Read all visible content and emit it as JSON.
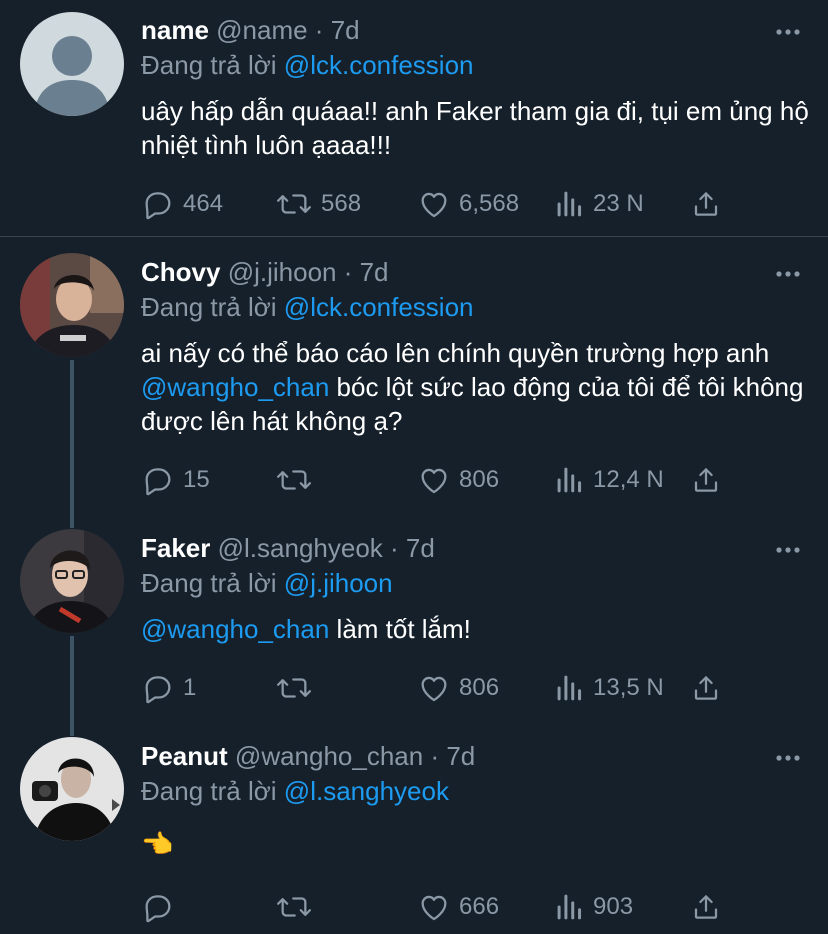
{
  "reply_prefix": "Đang trả lời",
  "tweets": [
    {
      "name": "name",
      "handle": "@name · 7d",
      "reply_to": "@lck.confession",
      "text": "uây hấp dẫn quáaa!! anh Faker tham gia đi, tụi em ủng hộ nhiệt tình luôn ạaaa!!!",
      "replies": "464",
      "retweets": "568",
      "likes": "6,568",
      "views": "23 N",
      "avatar_icon": "default-avatar"
    },
    {
      "name": "Chovy",
      "handle": "@j.jihoon · 7d",
      "reply_to": "@lck.confession",
      "text_before": "ai nấy có thể báo cáo lên chính quyền trường hợp anh ",
      "text_mention": "@wangho_chan",
      "text_after": " bóc lột sức lao động của tôi để tôi không được lên hát không ạ?",
      "replies": "15",
      "retweets": "",
      "likes": "806",
      "views": "12,4 N",
      "avatar_icon": "user-photo"
    },
    {
      "name": "Faker",
      "handle": "@l.sanghyeok · 7d",
      "reply_to": "@j.jihoon",
      "text_mention": "@wangho_chan",
      "text_after": " làm tốt lắm!",
      "replies": "1",
      "retweets": "",
      "likes": "806",
      "views": "13,5 N",
      "avatar_icon": "user-photo"
    },
    {
      "name": "Peanut",
      "handle": "@wangho_chan · 7d",
      "reply_to": "@l.sanghyeok",
      "emoji": "👈",
      "replies": "",
      "retweets": "",
      "likes": "666",
      "views": "903",
      "avatar_icon": "user-photo"
    }
  ],
  "colors": {
    "background": "#15202b",
    "text": "#ffffff",
    "secondary": "#8b98a5",
    "accent": "#1d9bf0",
    "divider": "#38444d"
  }
}
